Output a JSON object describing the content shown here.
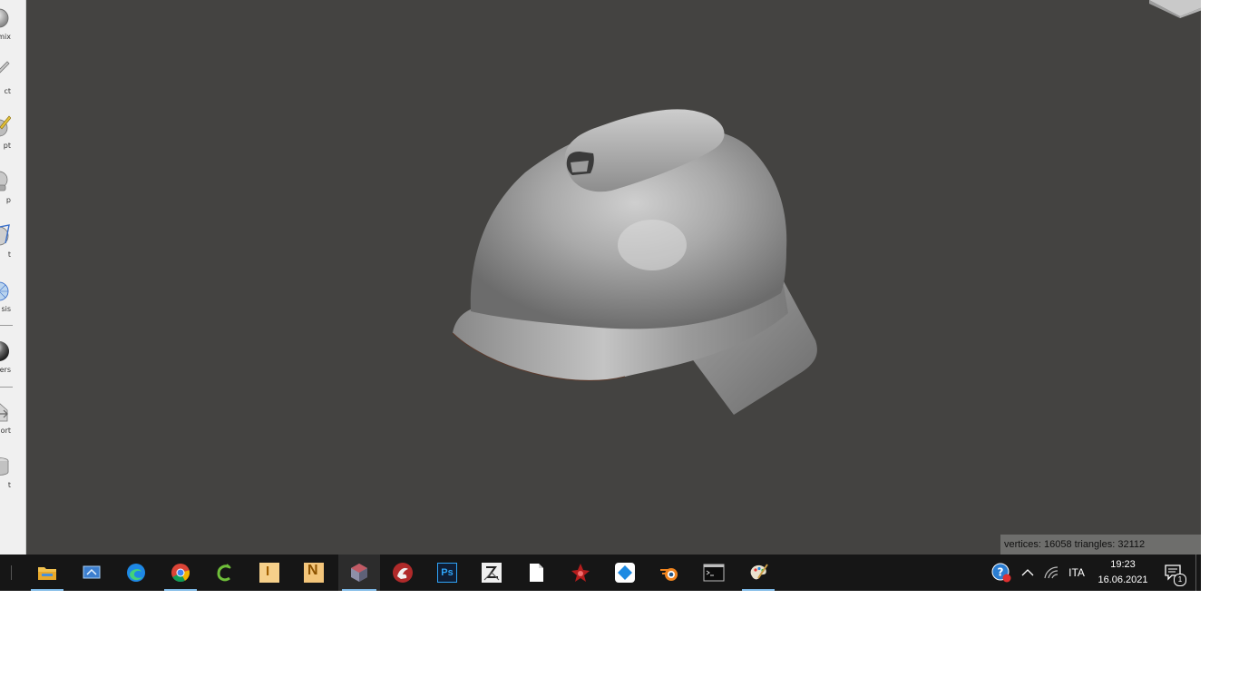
{
  "sidebar": {
    "tools": [
      {
        "label": "mix",
        "icon": "remix-icon"
      },
      {
        "label": "ct",
        "icon": "select-icon"
      },
      {
        "label": "pt",
        "icon": "sculpt-icon"
      },
      {
        "label": "p",
        "icon": "stamp-icon"
      },
      {
        "label": "t",
        "icon": "edit-icon"
      },
      {
        "label": "sis",
        "icon": "analysis-icon"
      },
      {
        "label": "ers",
        "icon": "shaders-icon"
      },
      {
        "label": "ort",
        "icon": "export-icon"
      },
      {
        "label": "t",
        "icon": "print-icon"
      }
    ]
  },
  "viewport": {
    "stats": "vertices: 16058 triangles: 32112"
  },
  "taskbar": {
    "apps": [
      {
        "name": "File Explorer",
        "icon": "file-explorer-icon",
        "running": true,
        "active": false
      },
      {
        "name": "Control Panel",
        "icon": "control-panel-icon",
        "running": false,
        "active": false
      },
      {
        "name": "Microsoft Edge",
        "icon": "edge-icon",
        "running": false,
        "active": false
      },
      {
        "name": "Google Chrome",
        "icon": "chrome-icon",
        "running": true,
        "active": false
      },
      {
        "name": "Cura",
        "icon": "cura-icon",
        "running": false,
        "active": false
      },
      {
        "name": "Inventor",
        "icon": "inventor-icon",
        "running": false,
        "active": false
      },
      {
        "name": "Netfabb",
        "icon": "netfabb-icon",
        "running": false,
        "active": false
      },
      {
        "name": "Meshmixer",
        "icon": "meshmixer-icon",
        "running": true,
        "active": true
      },
      {
        "name": "Krita",
        "icon": "krita-icon",
        "running": false,
        "active": false
      },
      {
        "name": "Photoshop",
        "icon": "photoshop-icon",
        "running": false,
        "active": false
      },
      {
        "name": "ZBrush",
        "icon": "zbrush-icon",
        "running": false,
        "active": false
      },
      {
        "name": "Document",
        "icon": "document-icon",
        "running": false,
        "active": false
      },
      {
        "name": "3DMark",
        "icon": "benchmark-icon",
        "running": false,
        "active": false
      },
      {
        "name": "Snip",
        "icon": "snip-icon",
        "running": false,
        "active": false
      },
      {
        "name": "Blender",
        "icon": "blender-icon",
        "running": false,
        "active": false
      },
      {
        "name": "Terminal",
        "icon": "terminal-icon",
        "running": false,
        "active": false
      },
      {
        "name": "Paint",
        "icon": "paint-icon",
        "running": true,
        "active": false
      }
    ],
    "photoshop_label": "Ps",
    "inventor_label": "I",
    "netfabb_label": "N",
    "language": "ITA",
    "time": "19:23",
    "date": "16.06.2021",
    "notification_count": "1"
  },
  "colors": {
    "viewport_bg": "#444341",
    "taskbar_bg": "#161616",
    "accent": "#7cb8e6"
  }
}
